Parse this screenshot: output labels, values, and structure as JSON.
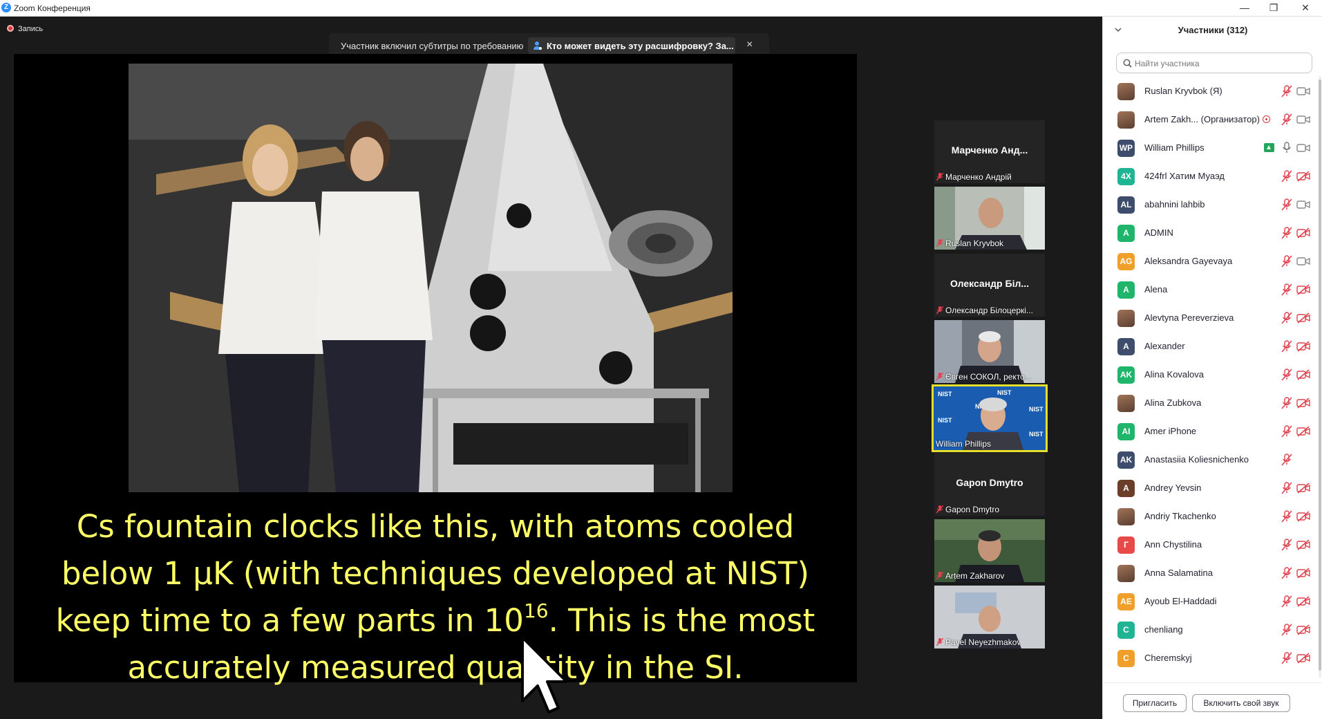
{
  "window": {
    "title": "Zoom Конференция",
    "logo": "Z",
    "minimize_icon": "—",
    "restore_icon": "❐",
    "close_icon": "✕"
  },
  "meeting": {
    "recording_label": "Запись",
    "caption_banner": {
      "message": "Участник включил субтитры по требованию",
      "link": "Кто может видеть эту расшифровку? За...",
      "close_icon": "×"
    },
    "slide": {
      "line1": "Cs fountain clocks like this, with atoms cooled",
      "line2": "below 1 μK (with techniques developed at NIST)",
      "line3_before": "keep time to a few parts in 10",
      "line3_sup": "16",
      "line3_after": ".  This is the most",
      "line4": "accurately measured quantity in the SI."
    },
    "video_tiles": [
      {
        "title": "Марченко Анд...",
        "label": "Марченко Андрій",
        "type": "name"
      },
      {
        "label": "Ruslan Kryvbok",
        "type": "video"
      },
      {
        "title": "Олександр Біл...",
        "label": "Олександр Білоцеркі...",
        "type": "name"
      },
      {
        "label": "Євген СОКОЛ, ректо...",
        "type": "video"
      },
      {
        "label": "William Phillips",
        "type": "video-active",
        "logo": "NIST"
      },
      {
        "title": "Gapon Dmytro",
        "label": "Gapon Dmytro",
        "type": "name"
      },
      {
        "label": "Artem Zakharov",
        "type": "video"
      },
      {
        "label": "Pavel Neyezhmakov",
        "type": "video"
      }
    ]
  },
  "participants_panel": {
    "title": "Участники (312)",
    "search_placeholder": "Найти участника",
    "participants": [
      {
        "initials": "",
        "name": "Ruslan Kryvbok (Я)",
        "color": "photo",
        "mic": "muted",
        "cam": "on"
      },
      {
        "initials": "",
        "name": "Artem Zakh... (Организатор)",
        "color": "photo",
        "mic": "muted",
        "cam": "on",
        "recording": true
      },
      {
        "initials": "WP",
        "name": "William Phillips",
        "color": "#3d4d6b",
        "mic": "active",
        "cam": "on",
        "sharing": true
      },
      {
        "initials": "4X",
        "name": "424frl Хатим Муаэд",
        "color": "#1fb594",
        "mic": "muted",
        "cam": "off"
      },
      {
        "initials": "AL",
        "name": "abahnini lahbib",
        "color": "#3d4d6b",
        "mic": "muted",
        "cam": "on"
      },
      {
        "initials": "A",
        "name": "ADMIN",
        "color": "#1fb56b",
        "mic": "muted",
        "cam": "off"
      },
      {
        "initials": "AG",
        "name": "Aleksandra Gayevaya",
        "color": "#f0a02a",
        "mic": "muted",
        "cam": "on"
      },
      {
        "initials": "A",
        "name": "Alena",
        "color": "#1fb56b",
        "mic": "muted",
        "cam": "off"
      },
      {
        "initials": "",
        "name": "Alevtyna Pereverzieva",
        "color": "photo",
        "mic": "muted",
        "cam": "off"
      },
      {
        "initials": "A",
        "name": "Alexander",
        "color": "#3d4d6b",
        "mic": "muted",
        "cam": "off"
      },
      {
        "initials": "AK",
        "name": "Alina Kovalova",
        "color": "#1fb56b",
        "mic": "muted",
        "cam": "off"
      },
      {
        "initials": "",
        "name": "Alina Zubkova",
        "color": "photo",
        "mic": "muted",
        "cam": "off"
      },
      {
        "initials": "AI",
        "name": "Amer iPhone",
        "color": "#1fb56b",
        "mic": "muted",
        "cam": "off"
      },
      {
        "initials": "AK",
        "name": "Anastasiia Koliesnichenko",
        "color": "#3d4d6b",
        "mic": "muted",
        "cam": "none"
      },
      {
        "initials": "A",
        "name": "Andrey Yevsin",
        "color": "#6b3e2a",
        "mic": "muted",
        "cam": "off"
      },
      {
        "initials": "",
        "name": "Andriy Tkachenko",
        "color": "photo",
        "mic": "muted",
        "cam": "off"
      },
      {
        "initials": "Г",
        "name": "Ann Chystilina",
        "color": "#e84a4a",
        "mic": "muted",
        "cam": "off"
      },
      {
        "initials": "",
        "name": "Anna Salamatina",
        "color": "photo",
        "mic": "muted",
        "cam": "off"
      },
      {
        "initials": "AE",
        "name": "Ayoub El-Haddadi",
        "color": "#f0a02a",
        "mic": "muted",
        "cam": "off"
      },
      {
        "initials": "C",
        "name": "chenliang",
        "color": "#1fb594",
        "mic": "muted",
        "cam": "off"
      },
      {
        "initials": "C",
        "name": "Cheremskyj",
        "color": "#f0a02a",
        "mic": "muted",
        "cam": "off"
      }
    ],
    "invite_button": "Пригласить",
    "unmute_button": "Включить свой звук"
  },
  "colors": {
    "slide_text": "#ffff66",
    "active_speaker_border": "#e6e02c",
    "muted_red": "#e0424d",
    "zoom_blue": "#2d8cff"
  }
}
